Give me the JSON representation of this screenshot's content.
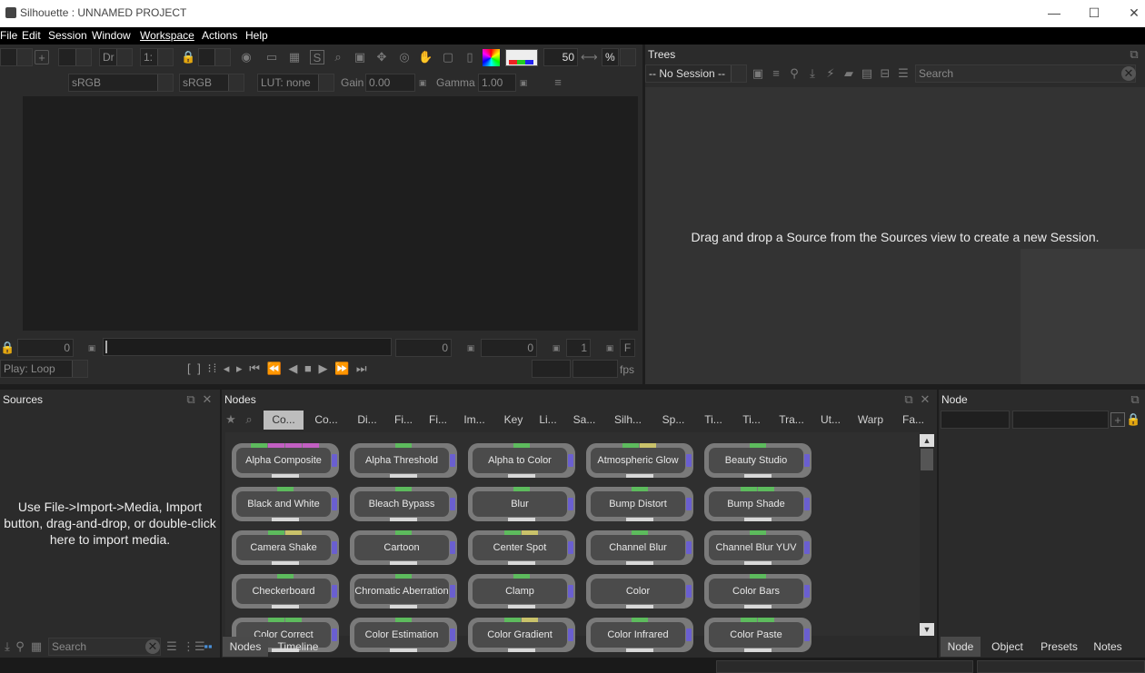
{
  "window": {
    "title": "Silhouette : UNNAMED PROJECT"
  },
  "menu": [
    "File",
    "Edit",
    "Session",
    "Window",
    "Workspace",
    "Actions",
    "Help"
  ],
  "viewer": {
    "view_select": "Dr",
    "ratio_select": "1:",
    "zoom_value": "50",
    "zoom_unit": "%",
    "colorspace_1": "sRGB",
    "colorspace_2": "sRGB",
    "lut": "LUT: none",
    "gain_label": "Gain",
    "gain_value": "0.00",
    "gamma_label": "Gamma",
    "gamma_value": "1.00",
    "frame_start": "0",
    "frame_in": "0",
    "frame_out": "0",
    "frame_step": "1",
    "f_button": "F",
    "play_mode": "Play: Loop",
    "fps_label": "fps"
  },
  "trees": {
    "title": "Trees",
    "session_select": "-- No Session --",
    "search_placeholder": "Search",
    "empty_message": "Drag and drop a Source from the Sources view to create a new Session."
  },
  "sources": {
    "title": "Sources",
    "empty_message_1": "Use File->Import->Media, Import",
    "empty_message_2": "button, drag-and-drop, or double-click",
    "empty_message_3": "here to import media.",
    "search_placeholder": "Search"
  },
  "nodes": {
    "title": "Nodes",
    "categories": [
      "Co...",
      "Co...",
      "Di...",
      "Fi...",
      "Fi...",
      "Im...",
      "Key",
      "Li...",
      "Sa...",
      "Silh...",
      "Sp...",
      "Ti...",
      "Ti...",
      "Tra...",
      "Ut...",
      "Warp",
      "Fa..."
    ],
    "items": [
      "Alpha Composite",
      "Alpha Threshold",
      "Alpha to Color",
      "Atmospheric Glow",
      "Beauty Studio",
      "Black and White",
      "Bleach Bypass",
      "Blur",
      "Bump Distort",
      "Bump Shade",
      "Camera Shake",
      "Cartoon",
      "Center Spot",
      "Channel Blur",
      "Channel Blur YUV",
      "Checkerboard",
      "Chromatic Aberration",
      "Clamp",
      "Color",
      "Color Bars",
      "Color Correct",
      "Color Estimation",
      "Color Gradient",
      "Color Infrared",
      "Color Paste"
    ],
    "bottom_tabs": [
      "Nodes",
      "Timeline"
    ]
  },
  "node_panel": {
    "title": "Node",
    "bottom_tabs": [
      "Node",
      "Object",
      "Presets",
      "Notes"
    ]
  },
  "colors": {
    "pin": "#6a5fd0",
    "bar_green": "#5dbb5d",
    "bar_magenta": "#c25fc2",
    "bar_yellow": "#c9c26a"
  }
}
